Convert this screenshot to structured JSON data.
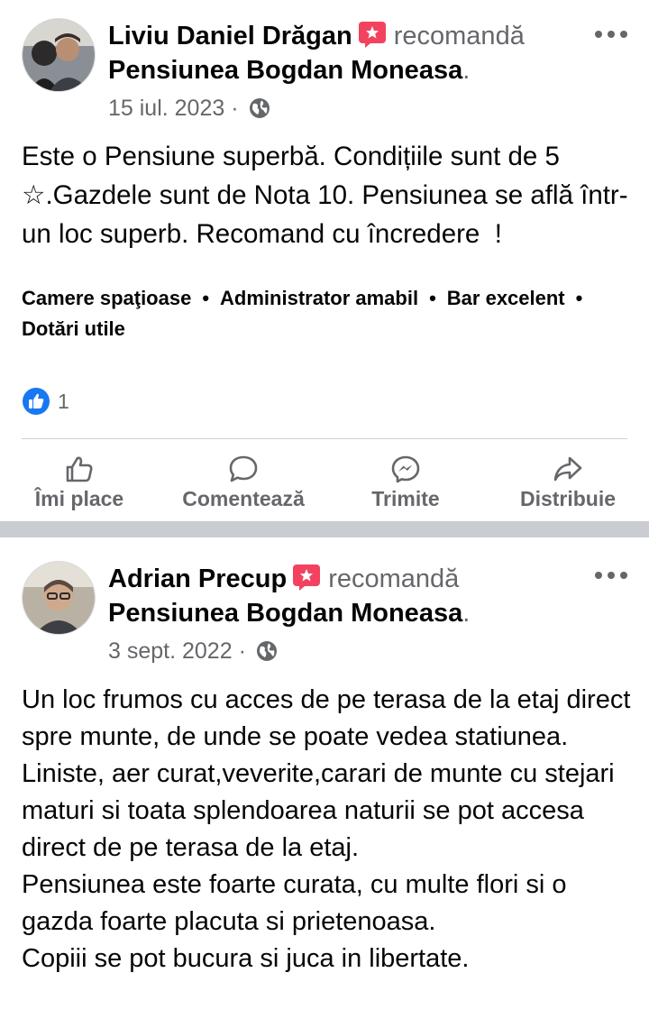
{
  "posts": [
    {
      "author": "Liviu Daniel Drăgan",
      "verb": "recomandă",
      "page": "Pensiunea Bogdan Moneasa",
      "date": "15 iul. 2023",
      "meta_sep": "·",
      "text": "Este o Pensiune superbă. Condițiile sunt de 5 ☆.Gazdele sunt de Nota 10. Pensiunea se află într-un loc superb. Recomand cu încredere  !",
      "tags": [
        "Camere spaţioase",
        "Administrator amabil",
        "Bar excelent",
        "Dotări utile"
      ],
      "reaction_count": "1",
      "actions": {
        "like": "Îmi place",
        "comment": "Comentează",
        "send": "Trimite",
        "share": "Distribuie"
      }
    },
    {
      "author": "Adrian Precup",
      "verb": "recomandă",
      "page": "Pensiunea Bogdan Moneasa",
      "date": "3 sept. 2022",
      "meta_sep": "·",
      "text": "Un loc frumos cu acces de pe terasa de la etaj direct spre munte, de unde se poate vedea statiunea. Liniste, aer curat,veverite,carari de munte cu stejari maturi si toata splendoarea naturii se pot accesa direct de pe terasa de la etaj.\nPensiunea este foarte curata, cu multe flori si o gazda foarte placuta si prietenoasa.\nCopiii se pot bucura si juca in libertate."
    }
  ],
  "colors": {
    "text": "#050505",
    "secondary": "#65676b",
    "like_blue": "#1877f2",
    "recommend_red": "#f3425f",
    "separator": "#c9ccd1"
  },
  "icons": [
    "recommend-badge-icon",
    "globe-icon",
    "more-options-icon",
    "like-icon",
    "comment-icon",
    "messenger-icon",
    "share-icon"
  ]
}
